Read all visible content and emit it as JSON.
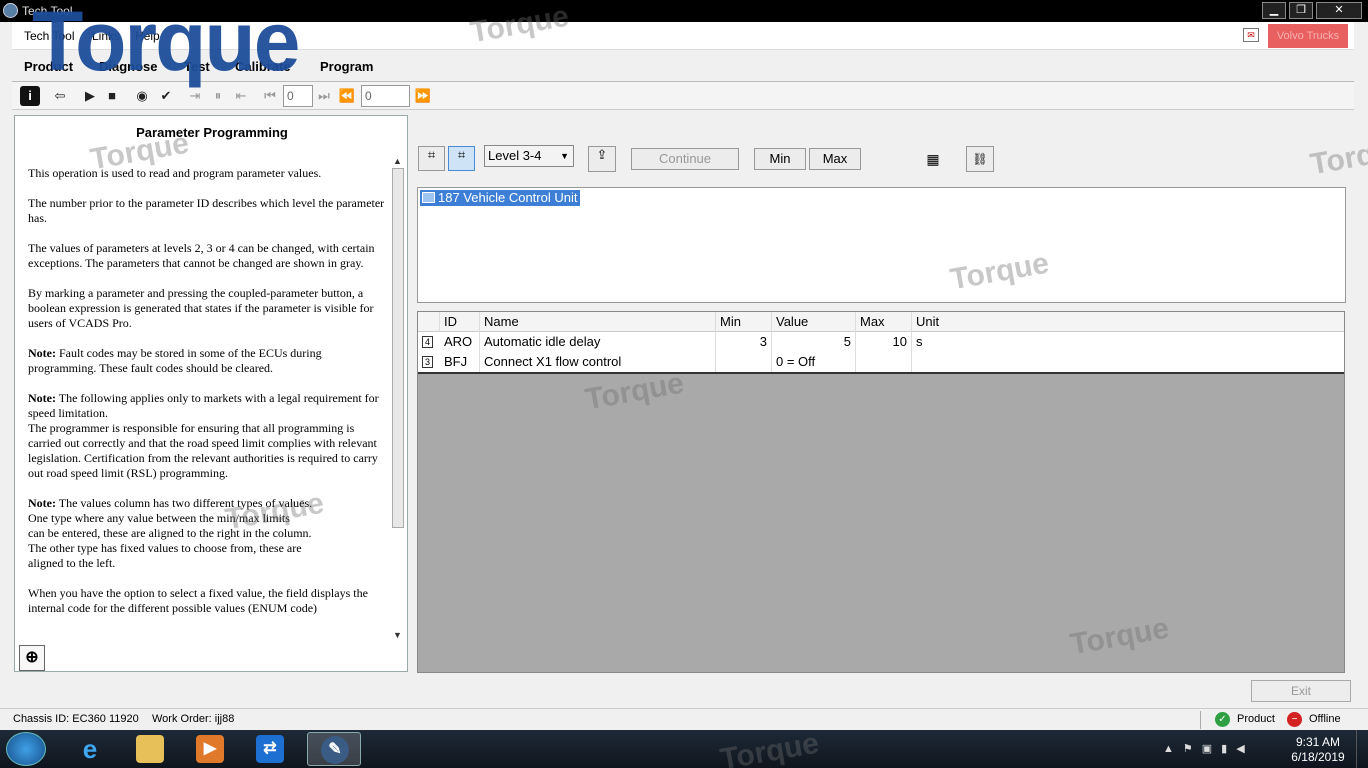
{
  "window": {
    "title": "Tech Tool",
    "min": "▁",
    "max": "❐",
    "close": "✕"
  },
  "menu": {
    "tech": "Tech Tool",
    "links": "Links",
    "help": "Help",
    "brand": "Volvo Trucks"
  },
  "nav": {
    "product": "Product",
    "diagnose": "Diagnose",
    "test": "Test",
    "calibrate": "Calibrate",
    "program": "Program"
  },
  "toolbar": {
    "field1": "0",
    "field2": "0"
  },
  "help": {
    "title": "Parameter Programming",
    "p1": "This operation is used to read and program parameter values.",
    "p2": "The number prior to the parameter ID describes which level the parameter has.",
    "p3": "The values of parameters at levels 2, 3 or 4 can be changed, with certain exceptions. The parameters that cannot be changed are shown in gray.",
    "p4": "By marking a parameter and pressing the coupled-parameter button, a boolean expression is generated that states if the parameter is visible for users of VCADS Pro.",
    "note_label": "Note:",
    "p5": " Fault codes may be stored in some of the ECUs during programming. These fault codes should be cleared.",
    "p6a": " The following applies only to markets with a legal requirement for speed limitation.",
    "p6b": "The programmer is responsible for ensuring that all programming is carried out correctly and that the road speed limit complies with relevant legislation. Certification from the relevant authorities is required to carry out road speed limit (RSL) programming.",
    "p7a": " The values column has two different types of values.",
    "p7b": "One type where any value between the min/max limits",
    "p7c": "can be entered, these are aligned to the right in the column.",
    "p7d": "The other type has fixed values to choose from, these are",
    "p7e": "aligned to the left.",
    "p8": "When you have the option to select a fixed value, the field displays the internal code for the different possible values (ENUM code)"
  },
  "controls": {
    "level": "Level 3-4",
    "continue": "Continue",
    "min": "Min",
    "max": "Max"
  },
  "ecu": {
    "label": "187  Vehicle Control Unit"
  },
  "grid": {
    "headers": {
      "id": "ID",
      "name": "Name",
      "min": "Min",
      "value": "Value",
      "max": "Max",
      "unit": "Unit"
    },
    "rows": [
      {
        "level": "4",
        "id": "ARO",
        "name": "Automatic idle delay",
        "min": "3",
        "value": "5",
        "max": "10",
        "unit": "s"
      },
      {
        "level": "3",
        "id": "BFJ",
        "name": "Connect X1 flow control",
        "min": "",
        "value": "0 = Off",
        "max": "",
        "unit": ""
      }
    ]
  },
  "footer": {
    "exit": "Exit"
  },
  "status": {
    "chassis": "Chassis ID: EC360 11920",
    "order": "Work Order: ijj88",
    "product": "Product",
    "offline": "Offline"
  },
  "taskbar": {
    "time": "9:31 AM",
    "date": "6/18/2019"
  },
  "watermark": {
    "logo": "Torque",
    "mark": "Torque"
  }
}
